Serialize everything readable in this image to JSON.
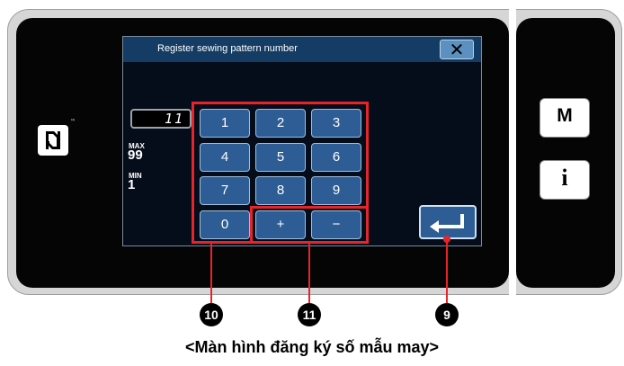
{
  "dialog": {
    "title": "Register sewing pattern number",
    "close_label": "✕"
  },
  "display": {
    "value": "11"
  },
  "limits": {
    "max_label": "MAX",
    "max_value": "99",
    "min_label": "MIN",
    "min_value": "1"
  },
  "keypad": {
    "digits": [
      "1",
      "2",
      "3",
      "4",
      "5",
      "6",
      "7",
      "8",
      "9",
      "0"
    ],
    "plus": "+",
    "minus": "−"
  },
  "side_buttons": {
    "mode": "M",
    "info": "i"
  },
  "nfc": {
    "icon": "nfc-icon",
    "tm": "™"
  },
  "enter": {
    "icon": "enter-arrow-icon"
  },
  "callouts": {
    "c10": "10",
    "c11": "11",
    "c9": "9"
  },
  "caption": "<Màn hình đăng ký số mẫu may>",
  "colors": {
    "highlight": "#e8242b",
    "key": "#2d5d94",
    "titlebar": "#143c64"
  }
}
